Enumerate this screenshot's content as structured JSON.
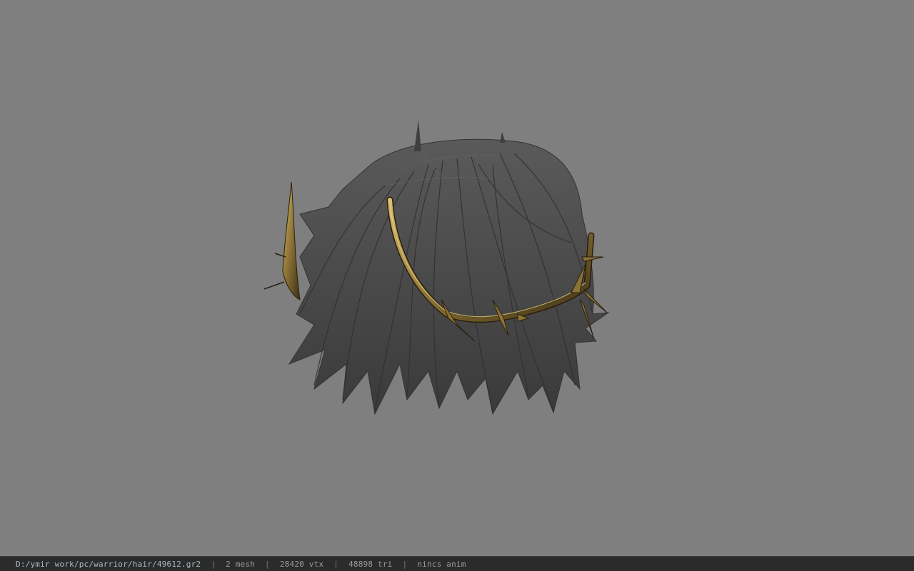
{
  "window": {
    "background_color": "#7f7f7f"
  },
  "viewport": {
    "model": "dark grey spiky hair mesh with golden thorn circlet",
    "hair_color": "#4a4a4a",
    "accessory_color": "#b89a45"
  },
  "statusbar": {
    "file_path": "D:/ymir work/pc/warrior/hair/49612.gr2",
    "separator": "|",
    "mesh_count": "2 mesh",
    "vertex_count": "28420 vtx",
    "triangle_count": "48898 tri",
    "anim_status": "nincs anim"
  }
}
